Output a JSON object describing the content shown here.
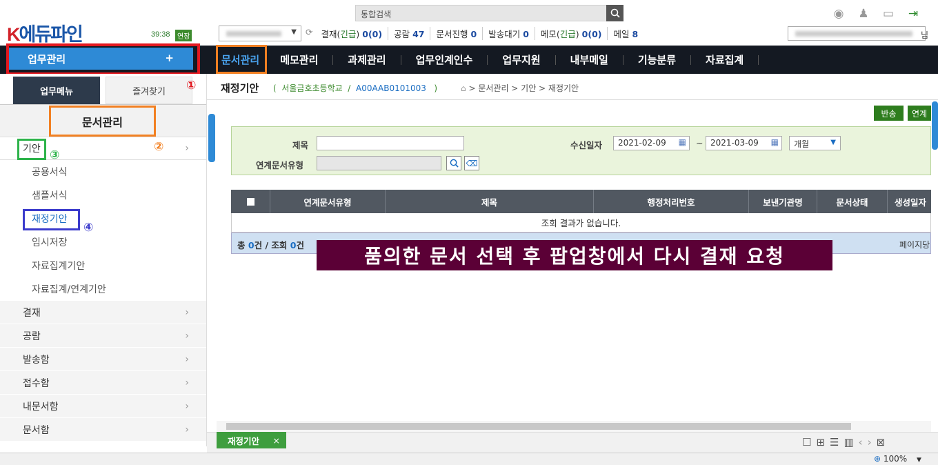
{
  "header": {
    "logo_k": "K",
    "logo_text": "에듀파인",
    "timer": "39:38",
    "extend_label": "연장",
    "search_placeholder": "통합검색",
    "status": [
      {
        "label": "결재(",
        "urgent": "긴급",
        "close": ") ",
        "value": "0",
        "extra": "(0)"
      },
      {
        "label": "공람",
        "value": "47"
      },
      {
        "label": "문서진행",
        "value": "0"
      },
      {
        "label": "발송대기",
        "value": "0"
      },
      {
        "label": "메모(",
        "urgent": "긴급",
        "close": ") ",
        "value": "0",
        "extra": "(0)"
      },
      {
        "label": "메일",
        "value": "8"
      }
    ],
    "user_suffix": "님",
    "icons": [
      "user-circle-icon",
      "user-settings-icon",
      "monitor-icon",
      "logout-icon"
    ]
  },
  "nav": {
    "work_button": "업무관리",
    "work_plus": "+",
    "items": [
      "문서관리",
      "메모관리",
      "과제관리",
      "업무인계인수",
      "업무지원",
      "내부메일",
      "기능분류",
      "자료집계"
    ]
  },
  "sidebar": {
    "tab_menu": "업무메뉴",
    "tab_fav": "즐겨찾기",
    "title": "문서관리",
    "category_open": "기안",
    "sub_items": [
      "공용서식",
      "샘플서식",
      "재정기안",
      "임시저장",
      "자료집계기안",
      "자료집계/연계기안"
    ],
    "categories": [
      "결재",
      "공람",
      "발송함",
      "접수함",
      "내문서함",
      "문서함"
    ]
  },
  "annotations": {
    "n1": "①",
    "n2": "②",
    "n3": "③",
    "n4": "④"
  },
  "page": {
    "title": "재정기안",
    "paren_open": "(",
    "school": "서울금호초등학교",
    "sep": "/",
    "code": "A00AAB0101003",
    "paren_close": ")",
    "breadcrumb": "> 문서관리 > 기안 > 재정기안",
    "btn_return": "반송",
    "btn_link": "연계"
  },
  "filter": {
    "title_label": "제목",
    "title_value": "",
    "recv_label": "수신일자",
    "date_from": "2021-02-09",
    "tilde": "~",
    "date_to": "2021-03-09",
    "period": "개월",
    "link_type_label": "연계문서유형",
    "link_type_value": ""
  },
  "table": {
    "columns": [
      "연계문서유형",
      "제목",
      "행정처리번호",
      "보낸기관명",
      "문서상태",
      "생성일자"
    ],
    "empty_message": "조회 결과가 없습니다.",
    "total_label": "총",
    "total_value": "0",
    "total_unit": "건",
    "query_label": "/ 조회",
    "query_value": "0",
    "query_unit": "건",
    "page_info": "페이지당"
  },
  "overlay_message": "품의한 문서 선택 후 팝업창에서 다시 결재 요청",
  "bottom": {
    "doc_tab": "재정기안",
    "doc_tab_close": "×",
    "zoom": "100%"
  }
}
